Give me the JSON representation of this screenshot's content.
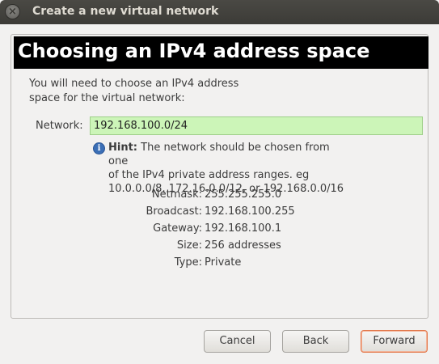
{
  "window": {
    "title": "Create a new virtual network",
    "close_glyph": "×"
  },
  "header": {
    "title": "Choosing an IPv4 address space"
  },
  "intro": {
    "line1": "You will need to choose an IPv4 address",
    "line2": "space for the virtual network:"
  },
  "network": {
    "label": "Network:",
    "value": "192.168.100.0/24",
    "field_color": "#ccf5b8"
  },
  "hint": {
    "icon": "info-icon",
    "icon_glyph": "i",
    "bold": "Hint:",
    "line1": " The network should be chosen from one",
    "line2": "of the IPv4 private address ranges. eg",
    "line3": "10.0.0.0/8,  172.16.0.0/12, or 192.168.0.0/16"
  },
  "details": [
    {
      "label": "Netmask:",
      "value": "255.255.255.0"
    },
    {
      "label": "Broadcast:",
      "value": "192.168.100.255"
    },
    {
      "label": "Gateway:",
      "value": "192.168.100.1"
    },
    {
      "label": "Size:",
      "value": "256 addresses"
    },
    {
      "label": "Type:",
      "value": "Private"
    }
  ],
  "buttons": {
    "cancel": "Cancel",
    "back": "Back",
    "forward": "Forward"
  }
}
